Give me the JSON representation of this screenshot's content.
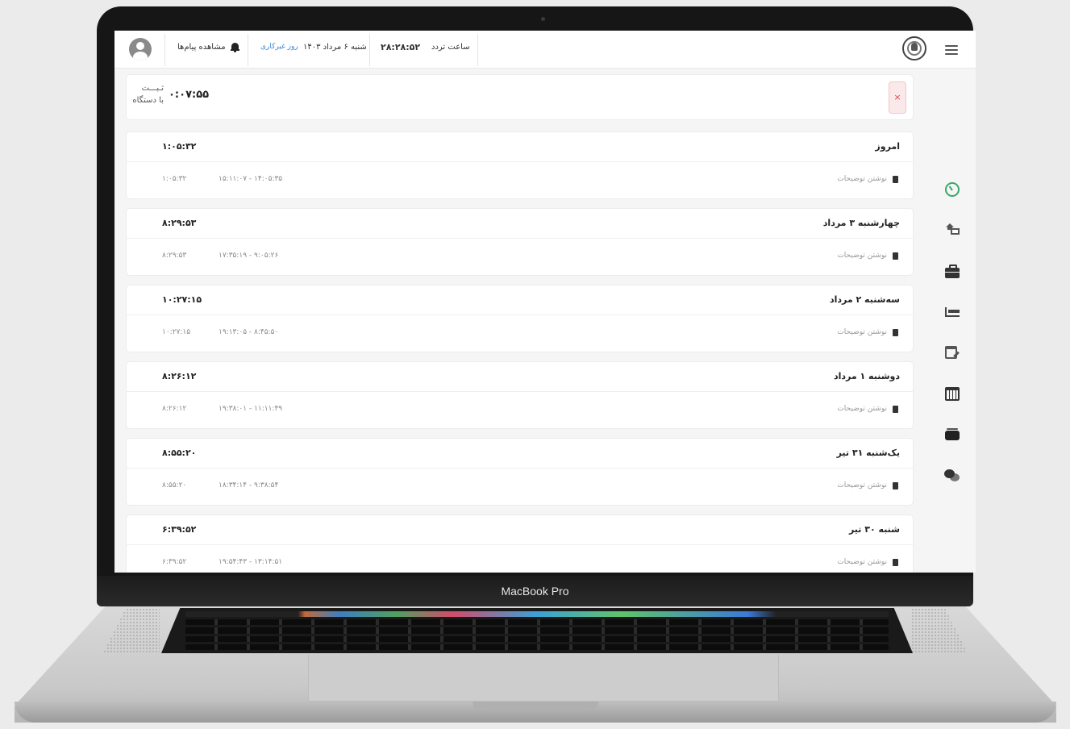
{
  "device": {
    "label": "MacBook Pro"
  },
  "topbar": {
    "messages_label": "مشاهده پیام‌ها",
    "day_type": "روز غیرکاری",
    "date": "شنبه ۶ مرداد ۱۴۰۳",
    "attendance_time": "۲۸:۲۸:۵۲",
    "attendance_label": "ساعت تردد"
  },
  "alert": {
    "label_line1": "ثـبـــت",
    "label_line2": "با دستگاه",
    "time": "۰:۰۷:۵۵",
    "close_symbol": "×"
  },
  "days": [
    {
      "title": "امروز",
      "total": "۱:۰۵:۳۲",
      "note": "نوشتن توضیحات",
      "range": "۱۵:۱۱:۰۷ - ۱۴:۰۵:۳۵",
      "row_total": "۱:۰۵:۳۲"
    },
    {
      "title": "چهارشنبه ۳ مرداد",
      "total": "۸:۲۹:۵۳",
      "note": "نوشتن توضیحات",
      "range": "۱۷:۳۵:۱۹ - ۹:۰۵:۲۶",
      "row_total": "۸:۲۹:۵۳"
    },
    {
      "title": "سه‌شنبه ۲ مرداد",
      "total": "۱۰:۲۷:۱۵",
      "note": "نوشتن توضیحات",
      "range": "۱۹:۱۳:۰۵ - ۸:۴۵:۵۰",
      "row_total": "۱۰:۲۷:۱۵"
    },
    {
      "title": "دوشنبه ۱ مرداد",
      "total": "۸:۲۶:۱۲",
      "note": "نوشتن توضیحات",
      "range": "۱۹:۳۸:۰۱ - ۱۱:۱۱:۴۹",
      "row_total": "۸:۲۶:۱۲"
    },
    {
      "title": "یک‌شنبه ۳۱ تیر",
      "total": "۸:۵۵:۲۰",
      "note": "نوشتن توضیحات",
      "range": "۱۸:۳۴:۱۴ - ۹:۳۸:۵۴",
      "row_total": "۸:۵۵:۲۰"
    },
    {
      "title": "شنبه ۳۰ تیر",
      "total": "۶:۳۹:۵۲",
      "note": "نوشتن توضیحات",
      "range": "۱۹:۵۴:۴۳ - ۱۳:۱۴:۵۱",
      "row_total": "۶:۳۹:۵۲"
    }
  ],
  "sidebar": {
    "icons": [
      "timer-icon",
      "home-transfer-icon",
      "briefcase-icon",
      "bed-icon",
      "edit-calendar-icon",
      "calendar-icon",
      "card-stack-icon",
      "chat-icon"
    ],
    "active_color": "#3aa86a"
  }
}
